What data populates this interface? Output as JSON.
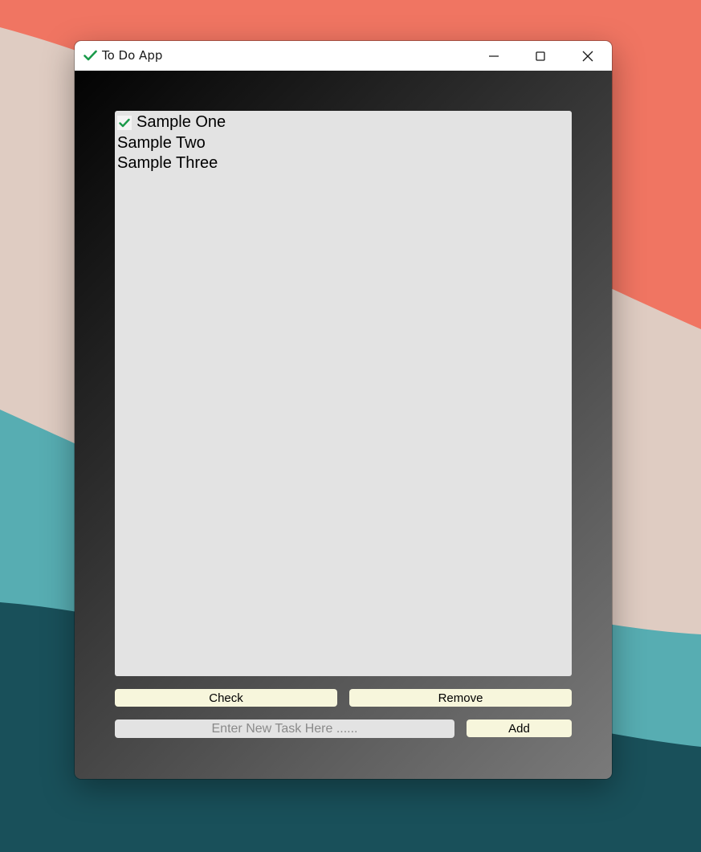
{
  "window": {
    "title": "To Do App",
    "icon": "checkmark-icon",
    "controls": [
      "minimize-icon",
      "maximize-icon",
      "close-icon"
    ]
  },
  "tasks": [
    {
      "label": "Sample One",
      "checked": true
    },
    {
      "label": "Sample Two",
      "checked": false
    },
    {
      "label": "Sample Three",
      "checked": false
    }
  ],
  "buttons": {
    "check_label": "Check",
    "remove_label": "Remove",
    "add_label": "Add"
  },
  "input": {
    "placeholder": "Enter New Task Here ......",
    "value": ""
  },
  "colors": {
    "check_green": "#1a9a4a",
    "button_bg": "#f7f6dc",
    "list_bg": "#e3e3e3"
  }
}
